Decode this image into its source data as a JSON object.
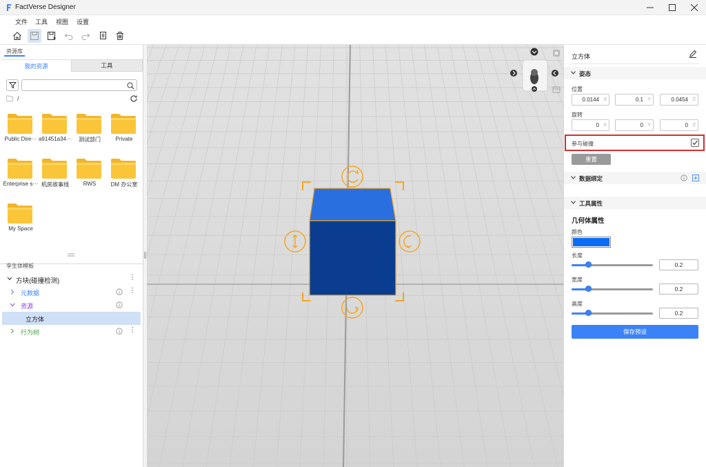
{
  "app": {
    "title": "FactVerse Designer"
  },
  "menu": {
    "file": "文件",
    "tools": "工具",
    "view": "视图",
    "settings": "设置"
  },
  "library": {
    "label": "资源库",
    "tabs": {
      "mine": "我的资源",
      "tools": "工具"
    },
    "path": "/",
    "folders": [
      {
        "label": "Public Dire···"
      },
      {
        "label": "a91451a34···"
      },
      {
        "label": "测试部门"
      },
      {
        "label": "Private"
      },
      {
        "label": "Enterprise s···"
      },
      {
        "label": "机房故事线"
      },
      {
        "label": "RWS"
      },
      {
        "label": "DM 办公室"
      },
      {
        "label": "My Space"
      }
    ]
  },
  "template": {
    "label": "孪生体模板",
    "root": "方块(碰撞检测)",
    "items": {
      "metadata": "元数据",
      "resources": "资源",
      "cube": "立方体",
      "behavior": "行为树"
    }
  },
  "inspector": {
    "object_name": "立方体",
    "posture": {
      "title": "姿态",
      "position_label": "位置",
      "position": {
        "x": "0.0144",
        "y": "0.1",
        "z": "0.0454"
      },
      "rotation_label": "旋转",
      "rotation": {
        "x": "0",
        "y": "0",
        "z": "0"
      },
      "axis_x": "X",
      "axis_y": "Y",
      "axis_z": "Z"
    },
    "collision_label": "参与碰撞",
    "collision_checked": true,
    "reset_label": "重置",
    "data_binding": {
      "title": "数据绑定"
    },
    "tool_props": {
      "title": "工具属性",
      "geometry_title": "几何体属性",
      "color_label": "颜色",
      "color_value": "#0a6cf5",
      "length_label": "长度",
      "length_value": "0.2",
      "length_fraction": 0.2,
      "width_label": "宽度",
      "width_value": "0.2",
      "width_fraction": 0.2,
      "height_label": "高度",
      "height_value": "0.2",
      "height_fraction": 0.2,
      "save_preset": "保存预设"
    }
  },
  "colors": {
    "accent": "#3b82f6",
    "highlight_border": "#d32f2f",
    "cube_top": "#2a6fe0",
    "cube_front": "#0a3d8f",
    "gizmo": "#f5a623"
  }
}
